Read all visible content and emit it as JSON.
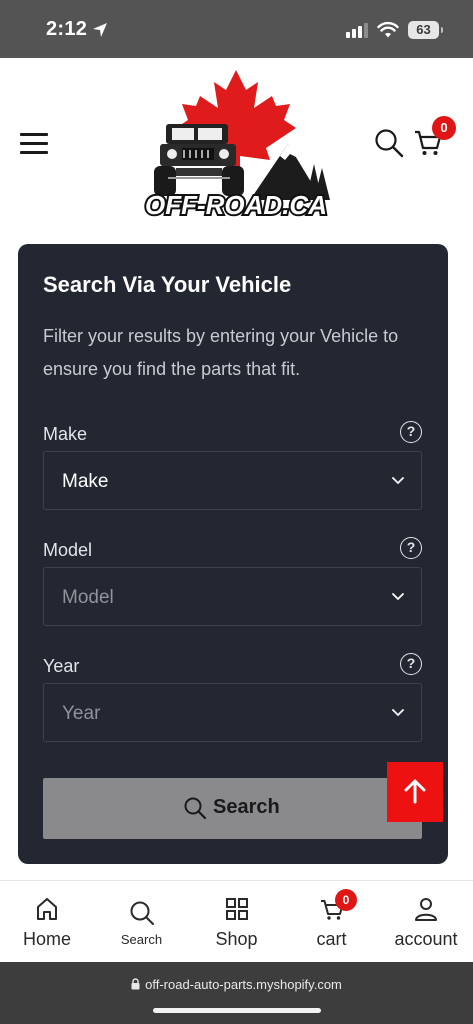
{
  "status_bar": {
    "time": "2:12",
    "battery": "63"
  },
  "header": {
    "logo_text": "OFF-ROAD.CA",
    "cart_count": "0"
  },
  "search_card": {
    "title": "Search Via Your Vehicle",
    "description": "Filter your results by entering your Vehicle to ensure you find the parts that fit.",
    "fields": [
      {
        "label": "Make",
        "value": "Make",
        "help": "?"
      },
      {
        "label": "Model",
        "value": "Model",
        "help": "?"
      },
      {
        "label": "Year",
        "value": "Year",
        "help": "?"
      }
    ],
    "search_label": "Search"
  },
  "bottom_nav": {
    "items": [
      {
        "label": "Home",
        "icon": "home-icon"
      },
      {
        "label": "Search",
        "icon": "search-icon"
      },
      {
        "label": "Shop",
        "icon": "grid-icon"
      },
      {
        "label": "cart",
        "icon": "cart-icon",
        "badge": "0"
      },
      {
        "label": "account",
        "icon": "user-icon"
      }
    ]
  },
  "browser": {
    "url": "off-road-auto-parts.myshopify.com"
  },
  "colors": {
    "card_bg": "#232732",
    "accent_red": "#ee1111",
    "search_button": "#8a8a8d"
  }
}
